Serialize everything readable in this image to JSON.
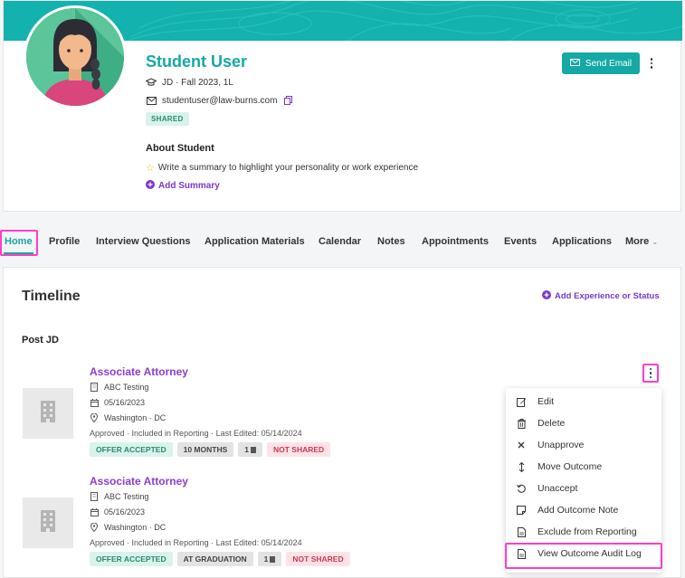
{
  "profile": {
    "name": "Student User",
    "program": "JD · Fall 2023, 1L",
    "email": "studentuser@law-burns.com",
    "shared_badge": "SHARED",
    "about_title": "About Student",
    "about_text": "Write a summary to highlight your personality or work experience",
    "add_summary": "Add Summary",
    "send_email": "Send Email"
  },
  "tabs": [
    {
      "label": "Home",
      "active": true
    },
    {
      "label": "Profile"
    },
    {
      "label": "Interview Questions"
    },
    {
      "label": "Application Materials"
    },
    {
      "label": "Calendar"
    },
    {
      "label": "Notes"
    },
    {
      "label": "Appointments"
    },
    {
      "label": "Events"
    },
    {
      "label": "Applications"
    },
    {
      "label": "More"
    }
  ],
  "timeline": {
    "title": "Timeline",
    "add_label": "Add Experience or Status",
    "section": "Post JD",
    "entries": [
      {
        "title": "Associate Attorney",
        "org": "ABC Testing",
        "date": "05/16/2023",
        "location": "Washington · DC",
        "status": "Approved · Included in Reporting · Last Edited: 05/14/2024",
        "badges": [
          "OFFER ACCEPTED",
          "10 MONTHS",
          "1",
          "NOT SHARED"
        ]
      },
      {
        "title": "Associate Attorney",
        "org": "ABC Testing",
        "date": "05/16/2023",
        "location": "Washington · DC",
        "status": "Approved · Included in Reporting · Last Edited: 05/14/2024",
        "badges": [
          "OFFER ACCEPTED",
          "AT GRADUATION",
          "1",
          "NOT SHARED"
        ]
      }
    ]
  },
  "menu": {
    "items": [
      {
        "label": "Edit",
        "icon": "edit-icon"
      },
      {
        "label": "Delete",
        "icon": "trash-icon"
      },
      {
        "label": "Unapprove",
        "icon": "x-icon"
      },
      {
        "label": "Move Outcome",
        "icon": "move-icon"
      },
      {
        "label": "Unaccept",
        "icon": "undo-icon"
      },
      {
        "label": "Add Outcome Note",
        "icon": "note-icon"
      },
      {
        "label": "Exclude from Reporting",
        "icon": "document-icon"
      },
      {
        "label": "View Outcome Audit Log",
        "icon": "document-icon"
      }
    ]
  },
  "colors": {
    "teal": "#14a9a4",
    "purple": "#7a39c9",
    "highlight": "#ff3fc4"
  }
}
